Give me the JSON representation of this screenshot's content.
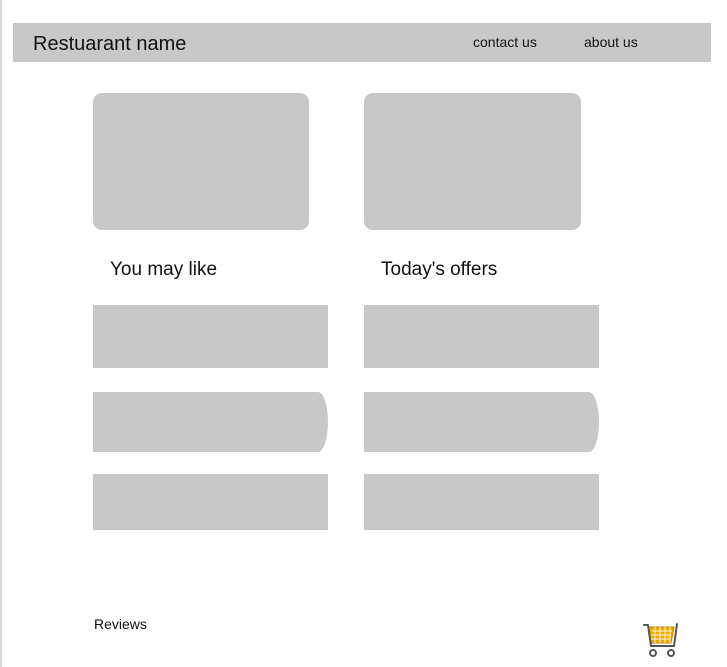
{
  "header": {
    "brand": "Restuarant name",
    "nav": {
      "contact": "contact us",
      "about": "about us"
    }
  },
  "sections": {
    "left_title": "You may like",
    "right_title": "Today's offers"
  },
  "footer": {
    "reviews": "Reviews"
  },
  "icons": {
    "cart": "shopping-cart-icon"
  },
  "colors": {
    "placeholder": "#c8c8c8",
    "cart_basket": "#f2a900",
    "cart_frame": "#555555"
  }
}
